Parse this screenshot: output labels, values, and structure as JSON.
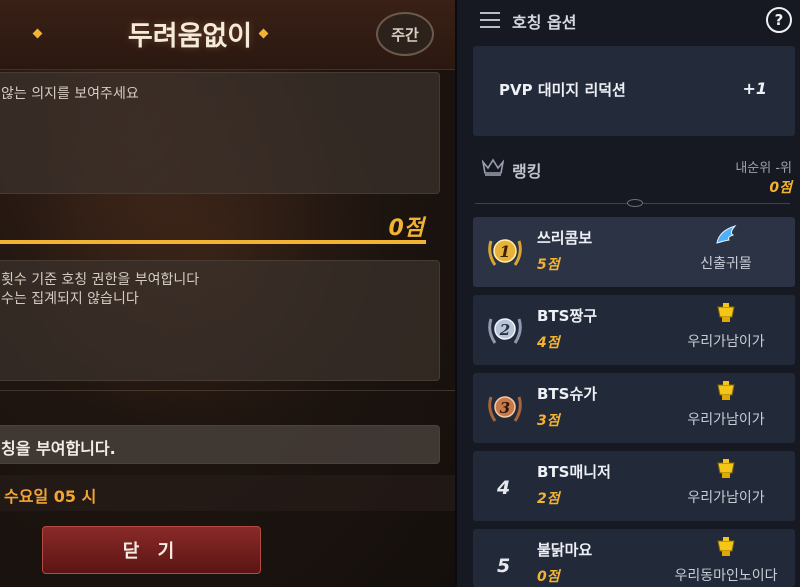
{
  "left_panel": {
    "title": "두려움없이",
    "weekly_badge": "주간",
    "description": "않는 의지를 보여주세요",
    "score": "0점",
    "info_lines": [
      "횟수 기준 호칭 권한을 부여합니다",
      "수는 집계되지 않습니다"
    ],
    "reward_text": "칭을 부여합니다.",
    "reset_time": "수요일 05 시",
    "close_label": "닫 기"
  },
  "right_panel": {
    "options_title": "호칭 옵션",
    "help": "?",
    "option": {
      "name": "PVP 대미지 리덕션",
      "value": "+1"
    },
    "ranking_title": "랭킹",
    "my_rank_label": "내순위 -위",
    "my_score": "0점",
    "rankings": [
      {
        "rank": "1",
        "name": "쓰리콤보",
        "score": "5점",
        "guild": "신출귀몰",
        "guild_icon": "wing-emblem"
      },
      {
        "rank": "2",
        "name": "BTS짱구",
        "score": "4점",
        "guild": "우리가남이가",
        "guild_icon": "gold-trophy-emblem"
      },
      {
        "rank": "3",
        "name": "BTS슈가",
        "score": "3점",
        "guild": "우리가남이가",
        "guild_icon": "gold-trophy-emblem"
      },
      {
        "rank": "4",
        "name": "BTS매니저",
        "score": "2점",
        "guild": "우리가남이가",
        "guild_icon": "gold-trophy-emblem"
      },
      {
        "rank": "5",
        "name": "불닭마요",
        "score": "0점",
        "guild": "우리동마인노이다",
        "guild_icon": "gold-trophy-emblem"
      }
    ],
    "colors": {
      "accent_gold": "#f2b233",
      "medal_gold": "#e8b23a",
      "medal_silver": "#b8c4d8",
      "medal_bronze": "#c7794a"
    }
  }
}
